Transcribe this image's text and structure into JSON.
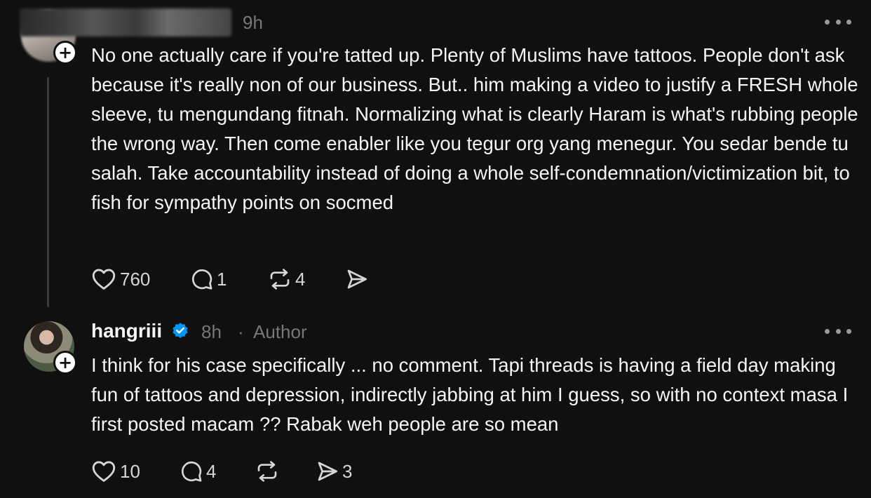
{
  "comment": {
    "time": "9h",
    "text": "No one actually care if you're tatted up. Plenty of Muslims have tattoos. People don't ask because it's really non of our business. But.. him making a video to justify a FRESH whole sleeve, tu mengundang fitnah. Normalizing what is clearly Haram is what's rubbing people the wrong way. Then come enabler like you tegur org yang menegur. You sedar bende tu salah. Take accountability instead of doing a whole self-condemnation/victimization bit, to fish for sympathy points on socmed",
    "likes": "760",
    "replies": "1",
    "reposts": "4",
    "shares": ""
  },
  "reply": {
    "username": "hangriii",
    "time": "8h",
    "separator": "·",
    "author_label": "Author",
    "text": "I think for his case specifically ... no comment. Tapi threads is having a field day making fun of tattoos and depression, indirectly jabbing at him I guess, so with no context masa I first posted macam ?? Rabak weh people are so mean",
    "likes": "10",
    "replies": "4",
    "reposts": "",
    "shares": "3"
  },
  "follow_badge_symbol": "+",
  "colors": {
    "background": "#101010",
    "text": "#f3f5f7",
    "muted": "#777777",
    "verified": "#0095f6"
  },
  "icons": [
    "heart-icon",
    "comment-icon",
    "repost-icon",
    "share-icon",
    "more-icon",
    "verified-badge-icon",
    "plus-icon"
  ]
}
